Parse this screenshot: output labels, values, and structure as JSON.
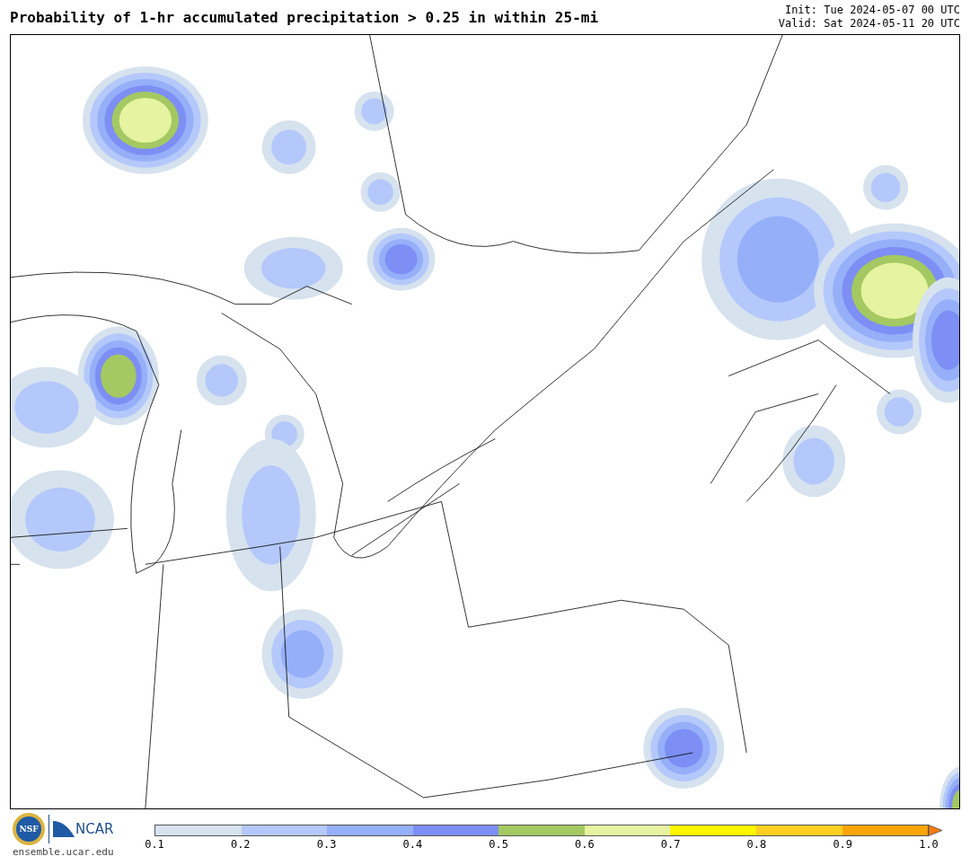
{
  "title": "Probability of 1-hr accumulated precipitation > 0.25 in within 25-mi",
  "init": "Init: Tue 2024-05-07 00 UTC",
  "valid": "Valid: Sat 2024-05-11 20 UTC",
  "logos": {
    "nsf": "NSF",
    "ncar": "NCAR",
    "site": "ensemble.ucar.edu"
  },
  "colorbar": {
    "bins": [
      {
        "kind": "bar",
        "color": "#d6e2ee"
      },
      {
        "kind": "bar",
        "color": "#b4c8fb"
      },
      {
        "kind": "bar",
        "color": "#95aff9"
      },
      {
        "kind": "bar",
        "color": "#7d8ef4"
      },
      {
        "kind": "bar",
        "color": "#a4c862"
      },
      {
        "kind": "bar",
        "color": "#e6f3a0"
      },
      {
        "kind": "bar",
        "color": "#fff600"
      },
      {
        "kind": "bar",
        "color": "#fdcf20"
      },
      {
        "kind": "bar",
        "color": "#fba40a"
      },
      {
        "kind": "arrow",
        "color": "#f57c0c"
      }
    ],
    "ticks": [
      "0.1",
      "0.2",
      "0.3",
      "0.4",
      "0.5",
      "0.6",
      "0.7",
      "0.8",
      "0.9",
      "1.0"
    ]
  }
}
